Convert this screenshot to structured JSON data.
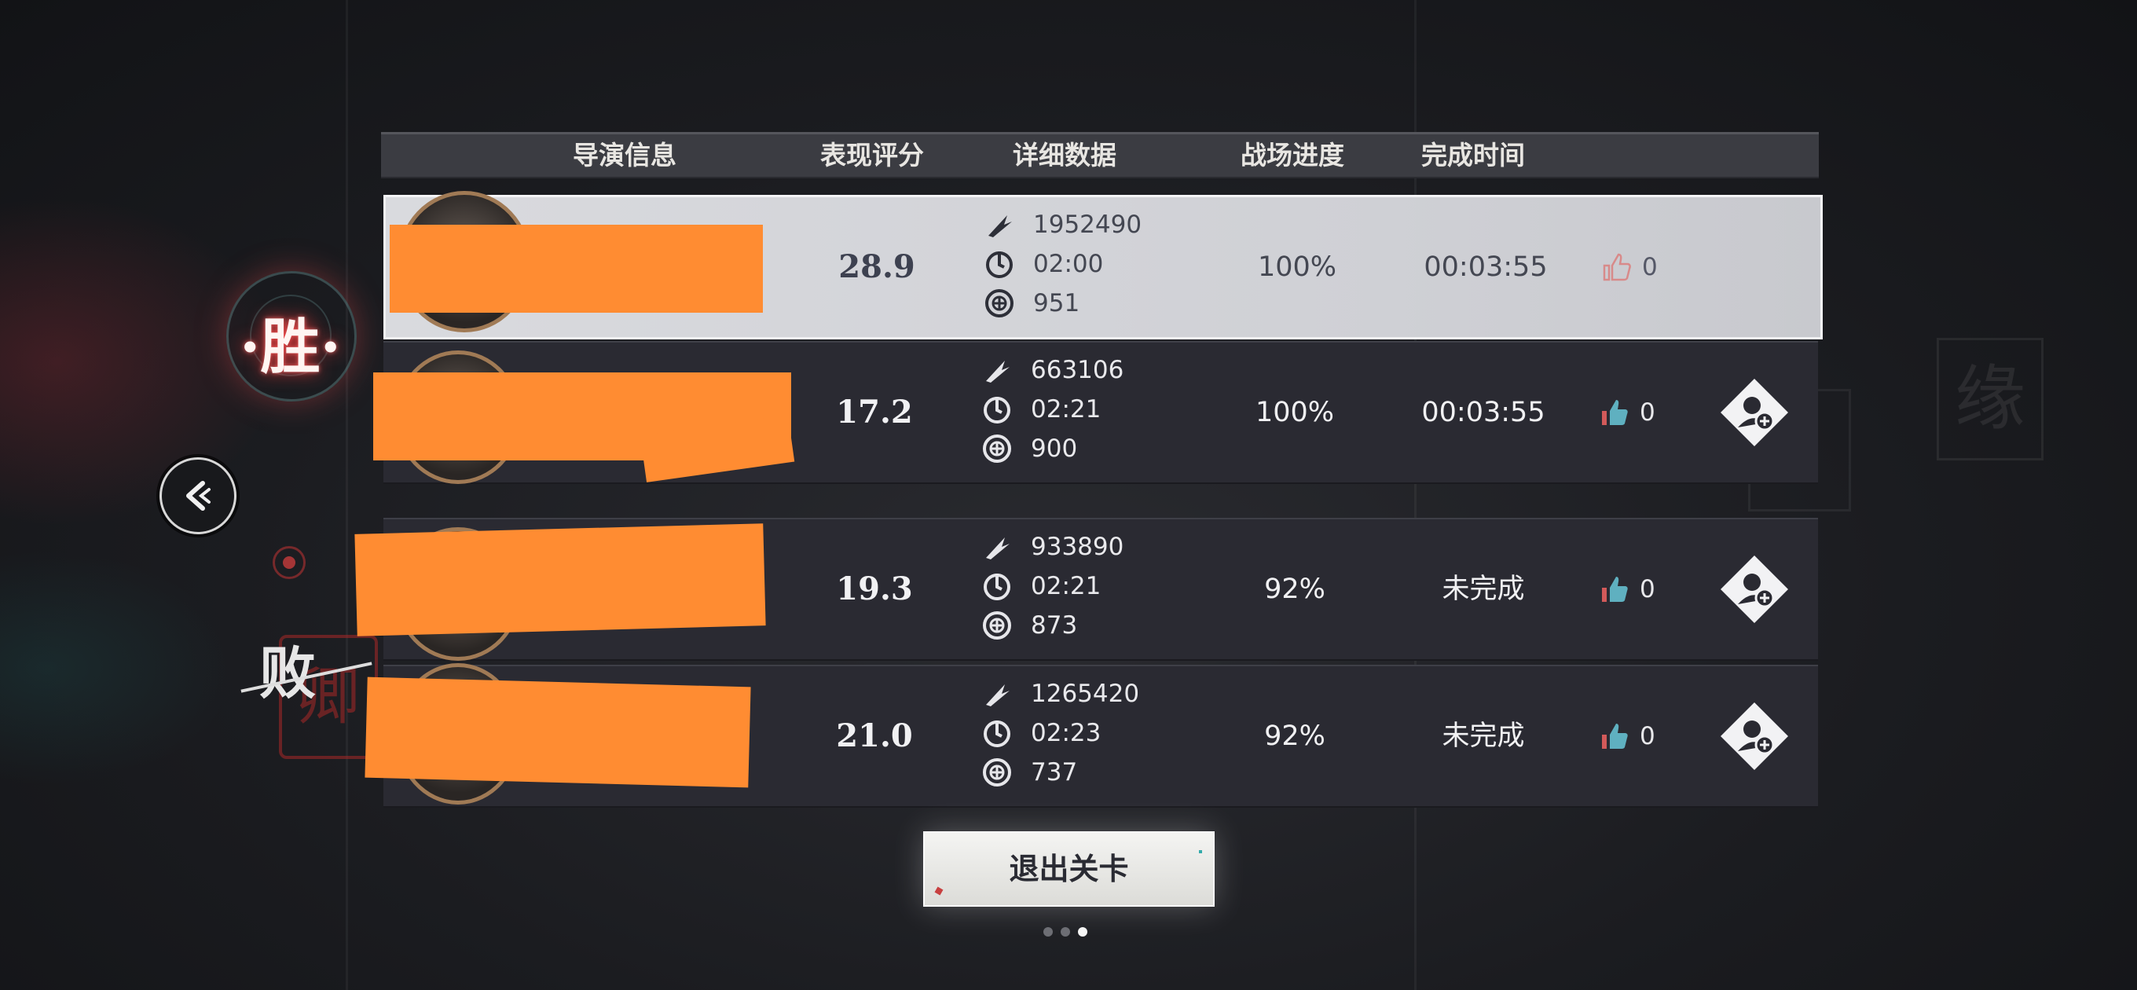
{
  "header": {
    "director_info": "导演信息",
    "performance_score": "表现评分",
    "detailed_data": "详细数据",
    "battle_progress": "战场进度",
    "completion_time": "完成时间"
  },
  "result_labels": {
    "win": "·胜·",
    "lose": "败"
  },
  "rows": [
    {
      "score": "28.9",
      "damage": "1952490",
      "time": "02:00",
      "points": "951",
      "progress": "100%",
      "finish_time": "00:03:55",
      "likes": "0"
    },
    {
      "score": "17.2",
      "damage": "663106",
      "time": "02:21",
      "points": "900",
      "progress": "100%",
      "finish_time": "00:03:55",
      "likes": "0"
    },
    {
      "score": "19.3",
      "damage": "933890",
      "time": "02:21",
      "points": "873",
      "progress": "92%",
      "finish_time": "未完成",
      "likes": "0"
    },
    {
      "score": "21.0",
      "damage": "1265420",
      "time": "02:23",
      "points": "737",
      "progress": "92%",
      "finish_time": "未完成",
      "likes": "0"
    }
  ],
  "exit_button": "退出关卡",
  "page_indicator": {
    "total": 3,
    "active": 3
  },
  "colors": {
    "redaction": "#ff8c32",
    "self_row_bg": "#d9dade",
    "row_bg": "#2a2a32"
  },
  "icons": [
    "damage-icon",
    "timer-icon",
    "points-icon",
    "thumbs-up-icon",
    "add-friend-icon",
    "back-arrow-icon"
  ]
}
